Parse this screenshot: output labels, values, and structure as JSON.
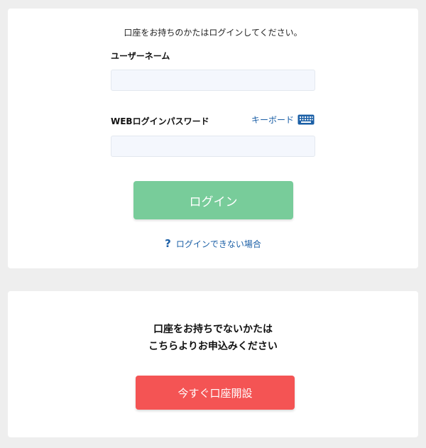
{
  "login_section": {
    "intro": "口座をお持ちのかたはログインしてください。",
    "username_label": "ユーザーネーム",
    "username_value": "",
    "password_label": "WEBログインパスワード",
    "password_value": "",
    "keyboard_label": "キーボード",
    "keyboard_icon": "keyboard-icon",
    "login_button_label": "ログイン",
    "help_icon": "?",
    "help_link_label": "ログインできない場合"
  },
  "signup_section": {
    "line1": "口座をお持ちでないかたは",
    "line2": "こちらよりお申込みください",
    "button_label": "今すぐ口座開設"
  },
  "colors": {
    "page_background": "#eeeeee",
    "card_background": "#ffffff",
    "input_background": "#f4f7fd",
    "link": "#1b5fa6",
    "login_button": "#78cc9a",
    "signup_button": "#f45454"
  }
}
